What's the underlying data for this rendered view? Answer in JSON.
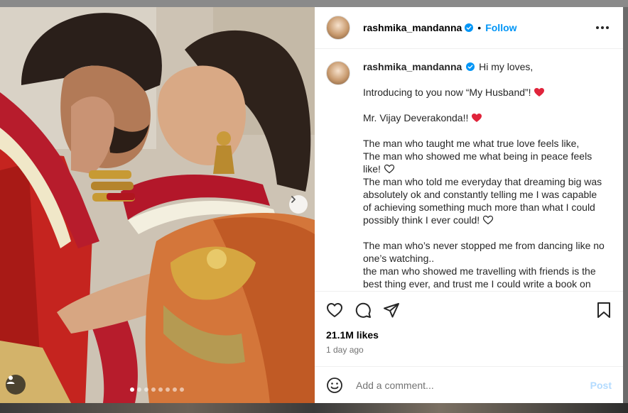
{
  "post": {
    "username": "rashmika_mandanna",
    "follow_label": "Follow",
    "separator": "•"
  },
  "caption": {
    "username": "rashmika_mandanna",
    "lines": [
      "Hi my loves,",
      "Introducing to you now “My Husband”!",
      "Mr. Vijay Deverakonda!!",
      "The man who taught me what true love feels like,",
      "The man who showed me what being in peace feels like!",
      "The man who told me everyday that dreaming big was absolutely ok and constantly telling me I was capable of achieving something much more than what I could possibly think I ever could!",
      "The man who’s never stopped me from dancing like no one’s watching..",
      "the man who showed me travelling with friends is the best thing ever, and trust me I could write a book on"
    ]
  },
  "stats": {
    "likes": "21.1M likes",
    "time": "1 day ago"
  },
  "comment": {
    "placeholder": "Add a comment...",
    "post_label": "Post"
  },
  "carousel": {
    "count": 8,
    "active_index": 0
  },
  "colors": {
    "accent": "#0095f6",
    "verified": "#0095f6",
    "heart": "#ed4956",
    "post_disabled": "#b3dbff"
  },
  "icons": {
    "like": "heart-icon",
    "comment": "comment-icon",
    "share": "share-icon",
    "save": "bookmark-icon",
    "emoji": "emoji-icon",
    "next": "chevron-right-icon",
    "tag": "user-tag-icon",
    "more": "more-icon",
    "verified": "verified-badge-icon"
  }
}
